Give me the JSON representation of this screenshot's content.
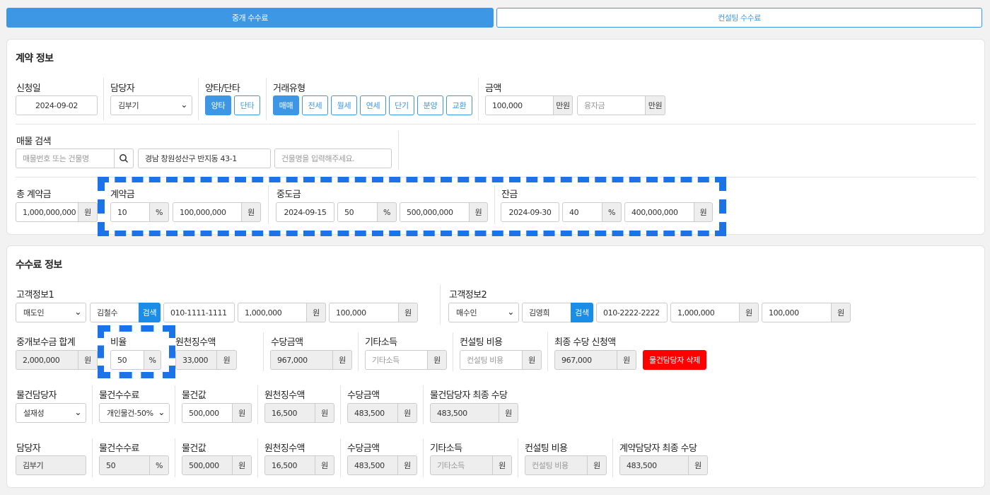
{
  "tabs": {
    "brokerage": "중개 수수료",
    "consulting": "컨설팅 수수료"
  },
  "contract": {
    "title": "계약 정보",
    "apply_date": {
      "label": "신청일",
      "value": "2024-09-02"
    },
    "manager": {
      "label": "담당자",
      "value": "김부기"
    },
    "side": {
      "label": "양타/단타",
      "options": [
        "양타",
        "단타"
      ],
      "selected": "양타"
    },
    "deal_type": {
      "label": "거래유형",
      "options": [
        "매매",
        "전세",
        "월세",
        "연세",
        "단기",
        "분양",
        "교환"
      ],
      "selected": "매매"
    },
    "amount": {
      "label": "금액",
      "value": "100,000",
      "unit": "만원",
      "loan_placeholder": "융자금",
      "loan_unit": "만원"
    },
    "property_search": {
      "label": "매물 검색",
      "placeholder": "매물번호 또는 건물명",
      "address": "경남 창원성산구 반지동 43-1",
      "building_placeholder": "건물명을 입력해주세요."
    },
    "total": {
      "label": "총 계약금",
      "value": "1,000,000,000",
      "unit": "원"
    },
    "deposit": {
      "label": "계약금",
      "ratio": "10",
      "pct": "%",
      "amount": "100,000,000",
      "unit": "원"
    },
    "middle": {
      "label": "중도금",
      "date": "2024-09-15",
      "ratio": "50",
      "pct": "%",
      "amount": "500,000,000",
      "unit": "원"
    },
    "balance": {
      "label": "잔금",
      "date": "2024-09-30",
      "ratio": "40",
      "pct": "%",
      "amount": "400,000,000",
      "unit": "원"
    }
  },
  "fee": {
    "title": "수수료 정보",
    "customer1": {
      "label": "고객정보1",
      "role": "매도인",
      "name": "김철수",
      "search": "검색",
      "phone": "010-1111-1111",
      "amount1": "1,000,000",
      "unit1": "원",
      "amount2": "100,000",
      "unit2": "원"
    },
    "customer2": {
      "label": "고객정보2",
      "role": "매수인",
      "name": "김영희",
      "search": "검색",
      "phone": "010-2222-2222",
      "amount1": "1,000,000",
      "unit1": "원",
      "amount2": "100,000",
      "unit2": "원"
    },
    "row2": {
      "total": {
        "label": "중개보수금 합계",
        "value": "2,000,000",
        "unit": "원"
      },
      "ratio": {
        "label": "비율",
        "value": "50",
        "unit": "%"
      },
      "withholding": {
        "label": "원천징수액",
        "value": "33,000",
        "unit": "원"
      },
      "allowance": {
        "label": "수당금액",
        "value": "967,000",
        "unit": "원"
      },
      "other_income": {
        "label": "기타소득",
        "placeholder": "기타소득",
        "unit": "원"
      },
      "consulting_cost": {
        "label": "컨설팅 비용",
        "placeholder": "컨설팅 비용",
        "unit": "원"
      },
      "final_request": {
        "label": "최종 수당 신청액",
        "value": "967,000",
        "unit": "원"
      },
      "delete_button": "물건담당자 삭제"
    },
    "row3": {
      "agent": {
        "label": "물건담당자",
        "value": "설재성"
      },
      "fee_type": {
        "label": "물건수수료",
        "value": "개인물건-50%"
      },
      "item_price": {
        "label": "물건값",
        "value": "500,000",
        "unit": "원"
      },
      "withholding": {
        "label": "원천징수액",
        "value": "16,500",
        "unit": "원"
      },
      "allowance": {
        "label": "수당금액",
        "value": "483,500",
        "unit": "원"
      },
      "final": {
        "label": "물건담당자 최종 수당",
        "value": "483,500",
        "unit": "원"
      }
    },
    "row4": {
      "manager": {
        "label": "담당자",
        "value": "김부기"
      },
      "fee": {
        "label": "물건수수료",
        "value": "50",
        "unit": "%"
      },
      "item_price": {
        "label": "물건값",
        "value": "500,000",
        "unit": "원"
      },
      "withholding": {
        "label": "원천징수액",
        "value": "16,500",
        "unit": "원"
      },
      "allowance": {
        "label": "수당금액",
        "value": "483,500",
        "unit": "원"
      },
      "other_income": {
        "label": "기타소득",
        "placeholder": "기타소득",
        "unit": "원"
      },
      "consulting_cost": {
        "label": "컨설팅 비용",
        "placeholder": "컨설팅 비용",
        "unit": "원"
      },
      "final": {
        "label": "계약담당자 최종 수당",
        "value": "483,500",
        "unit": "원"
      }
    }
  },
  "icons": {
    "search": "search-icon",
    "chevron": "chevron-down-icon"
  },
  "colors": {
    "accent": "#3d97e5",
    "danger": "#ff0000",
    "highlight": "#1c73e8"
  }
}
